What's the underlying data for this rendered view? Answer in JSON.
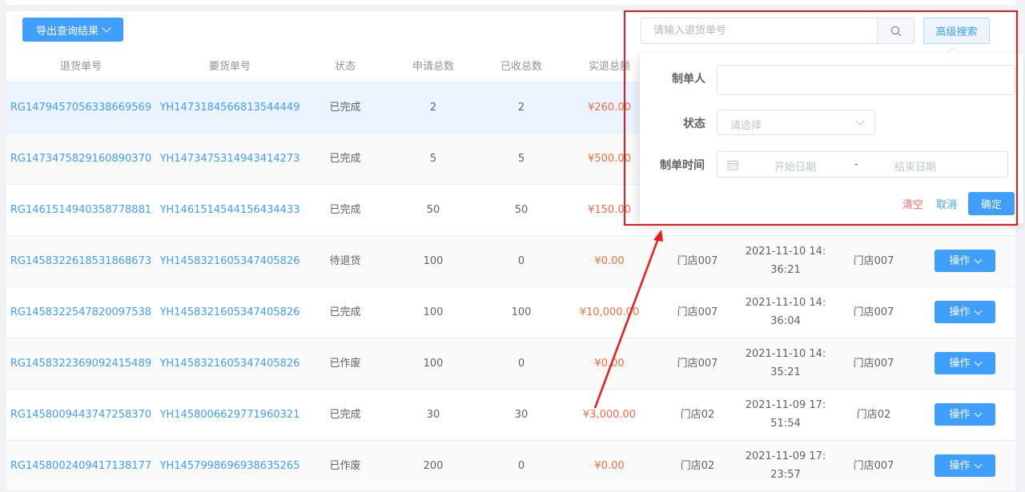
{
  "toolbar": {
    "export_label": "导出查询结果",
    "search_placeholder": "请输入退货单号",
    "advanced_label": "高级搜索"
  },
  "table": {
    "headers": [
      "退货单号",
      "要货单号",
      "状态",
      "申请总数",
      "已收总数",
      "实退总额",
      "",
      "",
      "",
      ""
    ],
    "rows": [
      {
        "return_no": "RG1479457056338669569",
        "request_no": "YH1473184566813544449",
        "status": "已完成",
        "applied": "2",
        "received": "2",
        "amount": "¥260.00",
        "store": "",
        "time_line1": "",
        "time_line2": "",
        "creator": "",
        "op": ""
      },
      {
        "return_no": "RG1473475829160890370",
        "request_no": "YH1473475314943414273",
        "status": "已完成",
        "applied": "5",
        "received": "5",
        "amount": "¥500.00",
        "store": "",
        "time_line1": "",
        "time_line2": "",
        "creator": "",
        "op": ""
      },
      {
        "return_no": "RG1461514940358778881",
        "request_no": "YH1461514544156434433",
        "status": "已完成",
        "applied": "50",
        "received": "50",
        "amount": "¥150.00",
        "store": "",
        "time_line1": "",
        "time_line2": "",
        "creator": "",
        "op": ""
      },
      {
        "return_no": "RG1458322618531868673",
        "request_no": "YH1458321605347405826",
        "status": "待退货",
        "applied": "100",
        "received": "0",
        "amount": "¥0.00",
        "store": "门店007",
        "time_line1": "2021-11-10 14:",
        "time_line2": "36:21",
        "creator": "门店007",
        "op": "操作"
      },
      {
        "return_no": "RG1458322547820097538",
        "request_no": "YH1458321605347405826",
        "status": "已完成",
        "applied": "100",
        "received": "100",
        "amount": "¥10,000.00",
        "store": "门店007",
        "time_line1": "2021-11-10 14:",
        "time_line2": "36:04",
        "creator": "门店007",
        "op": "操作"
      },
      {
        "return_no": "RG1458322369092415489",
        "request_no": "YH1458321605347405826",
        "status": "已作废",
        "applied": "100",
        "received": "0",
        "amount": "¥0.00",
        "store": "门店007",
        "time_line1": "2021-11-10 14:",
        "time_line2": "35:21",
        "creator": "门店007",
        "op": "操作"
      },
      {
        "return_no": "RG1458009443747258370",
        "request_no": "YH1458006629771960321",
        "status": "已完成",
        "applied": "30",
        "received": "30",
        "amount": "¥3,000.00",
        "store": "门店02",
        "time_line1": "2021-11-09 17:",
        "time_line2": "51:54",
        "creator": "门店02",
        "op": "操作"
      },
      {
        "return_no": "RG1458002409417138177",
        "request_no": "YH1457998696938635265",
        "status": "已作废",
        "applied": "200",
        "received": "0",
        "amount": "¥0.00",
        "store": "门店02",
        "time_line1": "2021-11-09 17:",
        "time_line2": "23:57",
        "creator": "门店007",
        "op": "操作"
      }
    ]
  },
  "advanced_search": {
    "creator_label": "制单人",
    "creator_value": "",
    "status_label": "状态",
    "status_placeholder": "请选择",
    "time_label": "制单时间",
    "start_placeholder": "开始日期",
    "separator": "-",
    "end_placeholder": "结束日期",
    "clear_label": "清空",
    "cancel_label": "取消",
    "confirm_label": "确定"
  },
  "colors": {
    "primary": "#409eff",
    "amount": "#f56c40",
    "annotation": "#f01818"
  }
}
